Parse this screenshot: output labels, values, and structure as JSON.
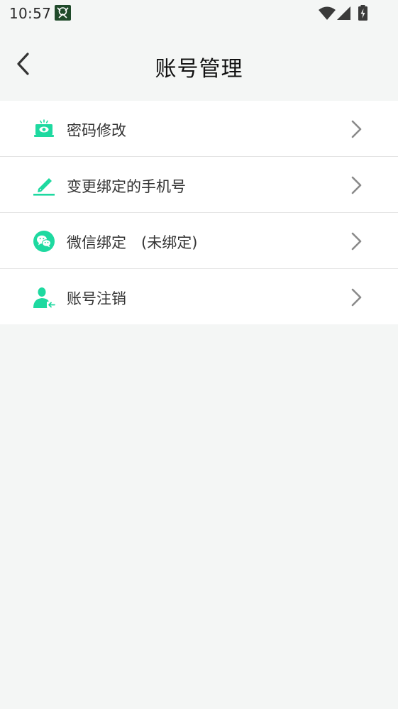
{
  "status_bar": {
    "time": "10:57"
  },
  "header": {
    "title": "账号管理"
  },
  "menu": {
    "items": [
      {
        "label": "密码修改",
        "icon": "laptop-eye-icon"
      },
      {
        "label": "变更绑定的手机号",
        "icon": "pencil-icon"
      },
      {
        "label": "微信绑定　(未绑定)",
        "icon": "wechat-icon"
      },
      {
        "label": "账号注销",
        "icon": "user-logout-icon"
      }
    ]
  },
  "colors": {
    "accent": "#1ed9a0",
    "background": "#f4f6f5",
    "chevron": "#8a8a8a"
  }
}
